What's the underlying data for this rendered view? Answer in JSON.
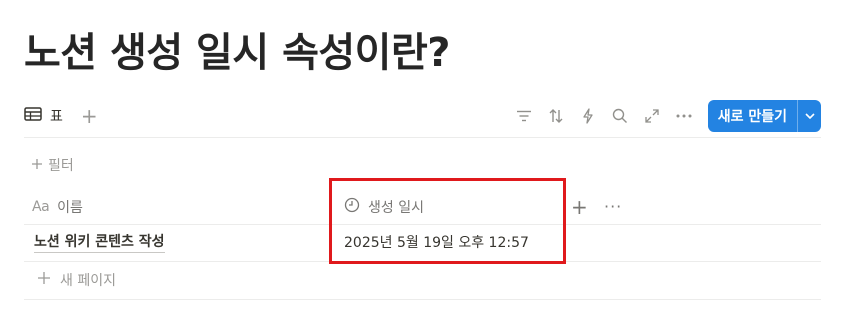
{
  "page": {
    "title": "노션 생성 일시 속성이란?"
  },
  "viewbar": {
    "tab_label": "표",
    "tab_icon": "table-icon",
    "add_view": "+",
    "tools": [
      "filter-icon",
      "sort-icon",
      "automation-icon",
      "search-icon",
      "expand-icon",
      "more-icon"
    ],
    "new_button": {
      "label": "새로 만들기",
      "caret_icon": "chevron-down-icon",
      "color": "#2383e2"
    }
  },
  "filter": {
    "label": "필터"
  },
  "table": {
    "columns": [
      {
        "label": "이름",
        "icon": "text-property-icon",
        "icon_text": "Aa"
      },
      {
        "label": "생성 일시",
        "icon": "clock-icon"
      }
    ],
    "add_column": "+",
    "more": "···",
    "rows": [
      {
        "name": "노션 위키 콘텐츠 작성",
        "created": "2025년 5월 19일 오후 12:57"
      }
    ],
    "new_page": "새 페이지"
  },
  "highlight_color": "#e0191c"
}
